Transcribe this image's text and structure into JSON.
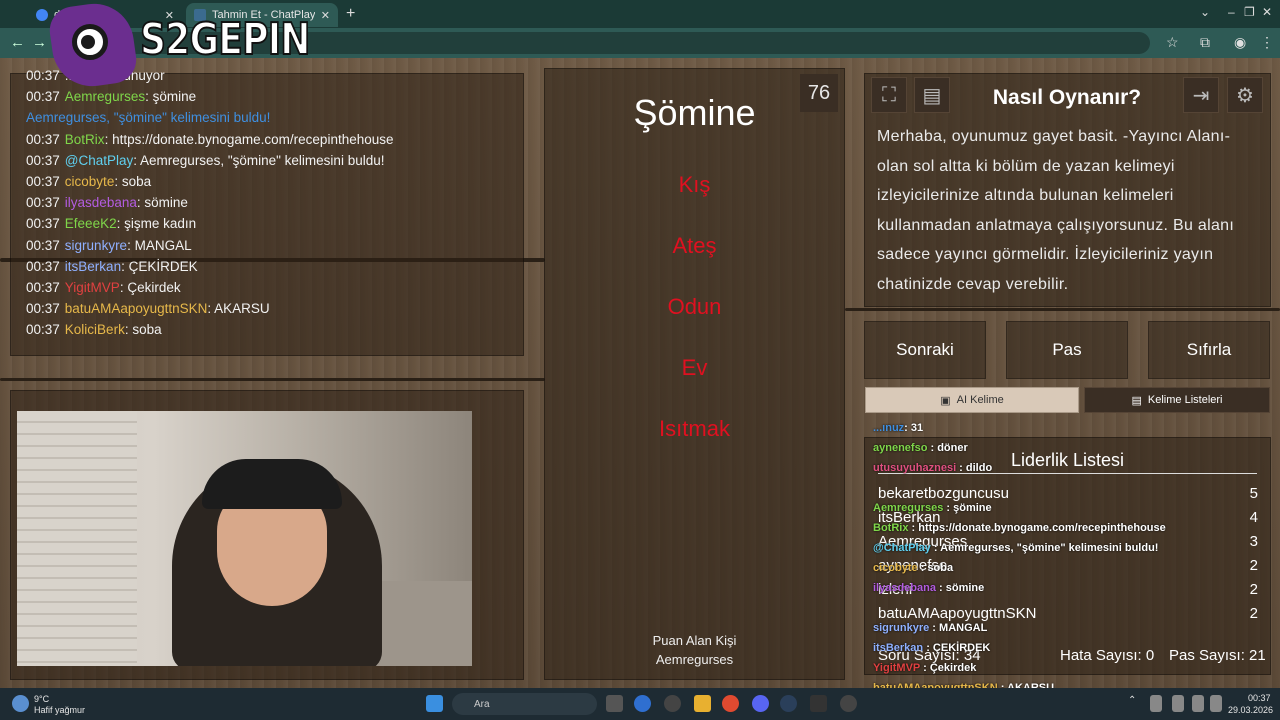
{
  "browser": {
    "tabs": [
      {
        "title": "d...da Ara",
        "favicon_color": "#4285f4"
      },
      {
        "title": "Tahmin Et - ChatPlay",
        "favicon_color": "#3b6b8f"
      }
    ],
    "new_tab": "+",
    "window_controls": [
      "⌄",
      "–",
      "❐",
      "✕"
    ]
  },
  "stream_logo": {
    "text": "S2GEPIN"
  },
  "chat": {
    "lines": [
      {
        "time": "00:37",
        "user": "",
        "user_color": "#ffffff",
        "message": "...gıvı dusunuyor"
      },
      {
        "time": "00:37",
        "user": "Aemregurses",
        "user_color": "#7fd64a",
        "message": ": şömine"
      },
      {
        "time": "",
        "user": "Aemregurses, \"şömine\" kelimesini buldu!",
        "user_color": "#3f8fe0",
        "message": ""
      },
      {
        "time": "00:37",
        "user": "BotRix",
        "user_color": "#7fd64a",
        "message": ": https://donate.bynogame.com/recepinthehouse"
      },
      {
        "time": "00:37",
        "user": "@ChatPlay",
        "user_color": "#5fd0f0",
        "message": ": Aemregurses, \"şömine\" kelimesini buldu!"
      },
      {
        "time": "00:37",
        "user": "cicobyte",
        "user_color": "#e6b84a",
        "message": ": soba"
      },
      {
        "time": "00:37",
        "user": "ilyasdebana",
        "user_color": "#b35ce0",
        "message": ": sömine"
      },
      {
        "time": "00:37",
        "user": "EfeeeK2",
        "user_color": "#7fd64a",
        "message": ": şişme kadın"
      },
      {
        "time": "00:37",
        "user": "sigrunkyre",
        "user_color": "#8fb0ff",
        "message": ": MANGAL"
      },
      {
        "time": "00:37",
        "user": "itsBerkan",
        "user_color": "#8fb0ff",
        "message": ": ÇEKİRDEK"
      },
      {
        "time": "00:37",
        "user": "YigitMVP",
        "user_color": "#e04040",
        "message": ": Çekirdek"
      },
      {
        "time": "00:37",
        "user": "batuAMAapoyugttnSKN",
        "user_color": "#e6b84a",
        "message": ": AKARSU"
      },
      {
        "time": "00:37",
        "user": "KoliciBerk",
        "user_color": "#e6b84a",
        "message": ": soba"
      }
    ]
  },
  "game": {
    "timer": "76",
    "word": "Şömine",
    "forbidden": [
      "Kış",
      "Ateş",
      "Odun",
      "Ev",
      "Isıtmak"
    ],
    "scorer_label": "Puan Alan Kişi",
    "scorer_name": "Aemregurses"
  },
  "how_to": {
    "title": "Nasıl Oynanır?",
    "text": "Merhaba, oyunumuz gayet basit. -Yayıncı Alanı- olan sol altta ki bölüm de yazan kelimeyi izleyicilerinize altında bulunan kelimeleri kullanmadan anlatmaya çalışıyorsunuz. Bu alanı sadece yayıncı görmelidir. İzleyicileriniz yayın chatinizde cevap verebilir."
  },
  "actions": {
    "next": "Sonraki",
    "pass": "Pas",
    "reset": "Sıfırla"
  },
  "small_buttons": {
    "ai_word": "AI Kelime",
    "word_lists": "Kelime Listeleri"
  },
  "leaderboard": {
    "title": "Liderlik Listesi",
    "rows": [
      {
        "name": "bekaretbozguncusu",
        "score": "5"
      },
      {
        "name": "itsBerkan",
        "score": "4"
      },
      {
        "name": "Aemregurses",
        "score": "3"
      },
      {
        "name": "aynenefso",
        "score": "2"
      },
      {
        "name": "izleni",
        "score": "2"
      },
      {
        "name": "batuAMAapoyugttnSKN",
        "score": "2"
      }
    ],
    "question_count": "Soru Sayısı: 34",
    "error_count": "Hata Sayısı: 0",
    "pass_count": "Pas Sayısı: 21"
  },
  "overlay_chat": [
    {
      "user": "...ınuz",
      "color": "#3f8fe0",
      "message": ": 31"
    },
    {
      "user": "aynenefso",
      "color": "#7fd64a",
      "message": " : döner"
    },
    {
      "user": "utusuyuhaznesi",
      "color": "#e05080",
      "message": " : dildo"
    },
    {
      "user": "Aemregurses",
      "color": "#7fd64a",
      "message": " : şömine"
    },
    {
      "user": "BotRix",
      "color": "#7fd64a",
      "message": " : https://donate.bynogame.com/recepinthehouse"
    },
    {
      "user": "@ChatPlay",
      "color": "#5fd0f0",
      "message": " : Aemregurses, \"şömine\" kelimesini buldu!"
    },
    {
      "user": "cicobyte",
      "color": "#e6b84a",
      "message": " : soba"
    },
    {
      "user": "ilyasdebana",
      "color": "#b35ce0",
      "message": " : sömine"
    },
    {
      "user": "sigrunkyre",
      "color": "#8fb0ff",
      "message": " : MANGAL"
    },
    {
      "user": "itsBerkan",
      "color": "#8fb0ff",
      "message": " : ÇEKİRDEK"
    },
    {
      "user": "YigitMVP",
      "color": "#e04040",
      "message": " : Çekirdek"
    },
    {
      "user": "batuAMAapoyugttnSKN",
      "color": "#e6b84a",
      "message": " : AKARSU"
    }
  ],
  "taskbar": {
    "weather_temp": "9°C",
    "weather_desc": "Hafif yağmur",
    "search_placeholder": "Ara",
    "time": "00:37",
    "date": "29.03.2026"
  }
}
